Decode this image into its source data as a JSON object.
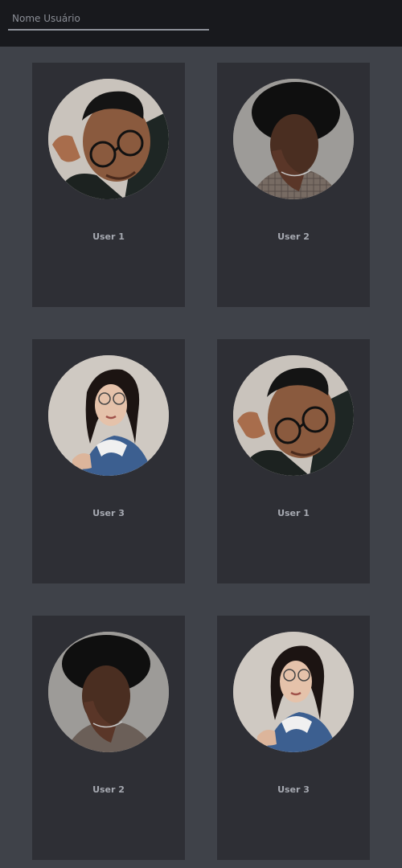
{
  "search": {
    "placeholder": "Nome Usuário",
    "value": ""
  },
  "cards": [
    {
      "name": "User 1",
      "avatar_icon": "user-1-portrait"
    },
    {
      "name": "User 2",
      "avatar_icon": "user-2-portrait"
    },
    {
      "name": "User 3",
      "avatar_icon": "user-3-portrait"
    },
    {
      "name": "User 1",
      "avatar_icon": "user-1-portrait"
    },
    {
      "name": "User 2",
      "avatar_icon": "user-2-portrait"
    },
    {
      "name": "User 3",
      "avatar_icon": "user-3-portrait"
    }
  ],
  "colors": {
    "page_bg": "#3f4249",
    "topbar_bg": "#18191d",
    "card_bg": "#2e2f35",
    "name_text": "#a6a9b1"
  }
}
